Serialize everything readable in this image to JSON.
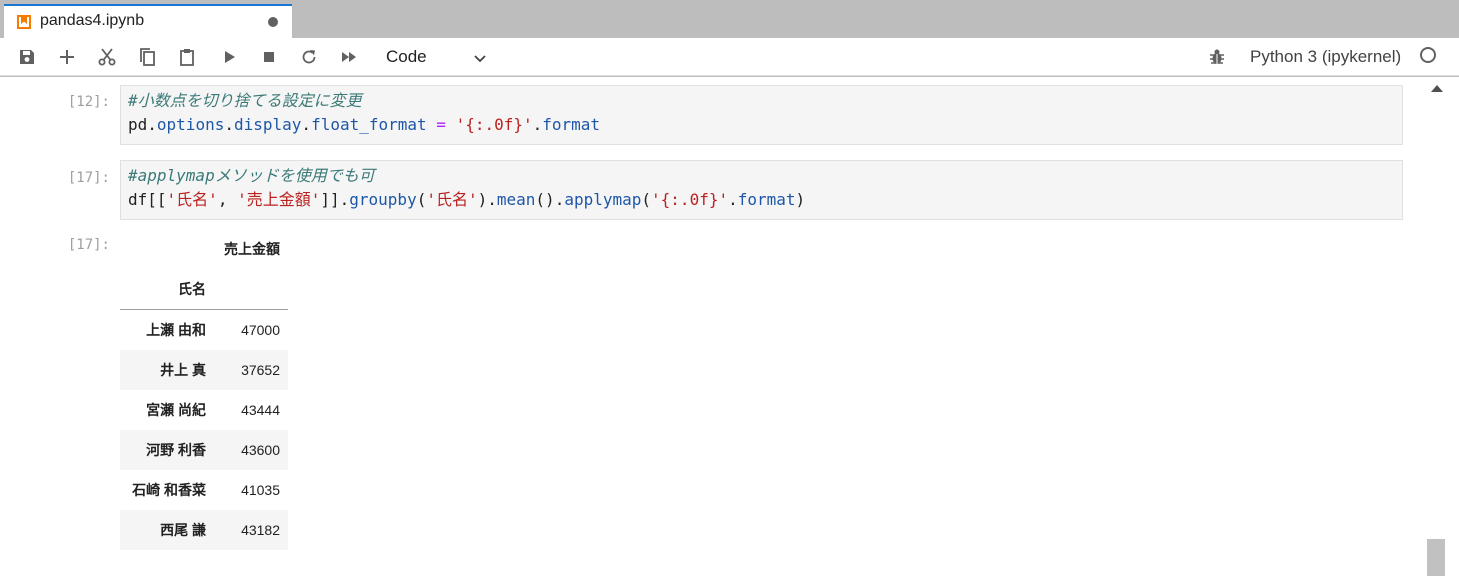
{
  "tab": {
    "title": "pandas4.ipynb"
  },
  "toolbar": {
    "cell_type": "Code",
    "kernel_name": "Python 3 (ipykernel)"
  },
  "cells": [
    {
      "prompt": "[12]:",
      "comment": "#小数点を切り捨てる設定に変更",
      "code_parts": [
        "pd",
        ".",
        "options",
        ".",
        "display",
        ".",
        "float_format",
        " = ",
        "'{:.0f}'",
        ".",
        "format"
      ]
    },
    {
      "prompt": "[17]:",
      "comment": "#applymapメソッドを使用でも可",
      "code_parts": [
        "df[[",
        "'氏名'",
        ", ",
        "'売上金額'",
        "]].",
        "groupby",
        "(",
        "'氏名'",
        ").",
        "mean",
        "().",
        "applymap",
        "(",
        "'{:.0f}'",
        ".",
        "format",
        ")"
      ]
    }
  ],
  "output": {
    "prompt": "[17]:",
    "column_header": "売上金額",
    "index_name": "氏名",
    "rows": [
      {
        "name": "上瀬 由和",
        "value": "47000"
      },
      {
        "name": "井上 真",
        "value": "37652"
      },
      {
        "name": "宮瀬 尚紀",
        "value": "43444"
      },
      {
        "name": "河野 利香",
        "value": "43600"
      },
      {
        "name": "石崎 和香菜",
        "value": "41035"
      },
      {
        "name": "西尾 謙",
        "value": "43182"
      }
    ]
  },
  "colors": {
    "accent": "#1976d2",
    "tab_icon": "#f57c00",
    "comment": "#3b7a78",
    "string": "#ba2121",
    "property": "#1e56a8",
    "operator": "#aa22ff"
  }
}
